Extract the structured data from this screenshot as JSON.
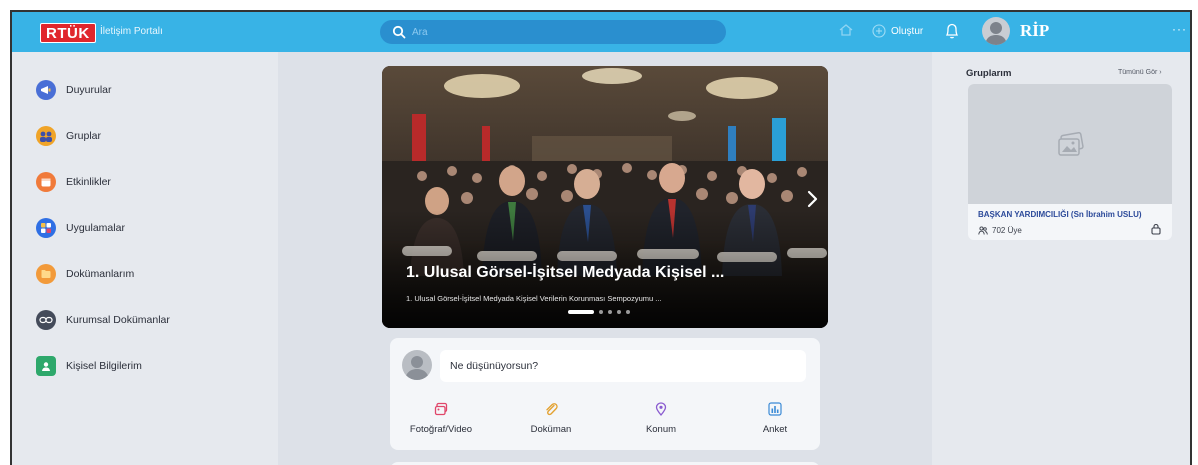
{
  "topbar": {
    "logo": "RTÜK",
    "portal_title": "İletişim Portalı",
    "search_placeholder": "Ara",
    "create_label": "Oluştur",
    "user_name": "RİP",
    "more": "···"
  },
  "sidebar": {
    "items": [
      {
        "label": "Duyurular",
        "icon": "announcement-icon",
        "color": "#4a6fd6"
      },
      {
        "label": "Gruplar",
        "icon": "groups-icon",
        "color": "#f0a428"
      },
      {
        "label": "Etkinlikler",
        "icon": "calendar-icon",
        "color": "#f07a3a"
      },
      {
        "label": "Uygulamalar",
        "icon": "apps-icon",
        "color": "#2f6fe4"
      },
      {
        "label": "Dokümanlarım",
        "icon": "documents-icon",
        "color": "#f29a3a"
      },
      {
        "label": "Kurumsal Dokümanlar",
        "icon": "link-icon",
        "color": "#444b5a"
      },
      {
        "label": "Kişisel Bilgilerim",
        "icon": "profile-icon",
        "color": "#2ea86b"
      }
    ]
  },
  "slider": {
    "title": "1. Ulusal Görsel-İşitsel Medyada Kişisel ...",
    "subtitle": "1. Ulusal Görsel-İşitsel Medyada Kişisel Verilerin Korunması Sempozyumu ...",
    "slide_count": 5,
    "active_slide": 1
  },
  "composer": {
    "placeholder": "Ne düşünüyorsun?",
    "actions": [
      {
        "label": "Fotoğraf/Video",
        "icon": "photo-icon",
        "color": "#e0466a"
      },
      {
        "label": "Doküman",
        "icon": "attachment-icon",
        "color": "#e3a232"
      },
      {
        "label": "Konum",
        "icon": "location-icon",
        "color": "#8a5bd0"
      },
      {
        "label": "Anket",
        "icon": "poll-icon",
        "color": "#3a8ad6"
      }
    ]
  },
  "groups": {
    "title": "Gruplarım",
    "see_all": "Tümünü Gör ›",
    "items": [
      {
        "name": "BAŞKAN YARDIMCILIĞI (Sn İbrahim USLU)",
        "members": "702 Üye"
      }
    ]
  }
}
